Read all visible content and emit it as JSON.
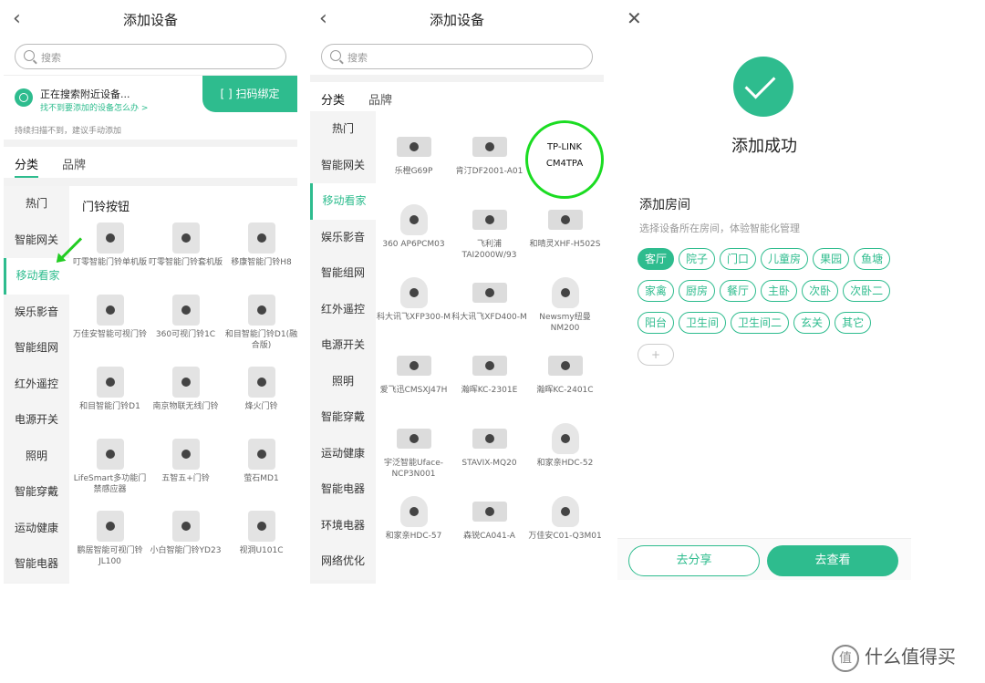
{
  "p1": {
    "title": "添加设备",
    "search_ph": "搜索",
    "scan1": "正在搜索附近设备...",
    "scan2": "找不到要添加的设备怎么办 >",
    "scan3": "持续扫描不到，建议手动添加",
    "scan_btn": "[ ] 扫码绑定",
    "tab1": "分类",
    "tab2": "品牌",
    "section": "门铃按钮",
    "side": [
      "热门",
      "智能网关",
      "移动看家",
      "娱乐影音",
      "智能组网",
      "红外遥控",
      "电源开关",
      "照明",
      "智能穿戴",
      "运动健康",
      "智能电器"
    ],
    "devices": [
      "叮零智能门铃单机版",
      "叮零智能门铃套机版",
      "移康智能门铃H8",
      "万佳安智能可视门铃",
      "360可视门铃1C",
      "和目智能门铃D1(融合版)",
      "和目智能门铃D1",
      "南京物联无线门铃",
      "烽火门铃",
      "LifeSmart多功能门禁感应器",
      "五智五+门铃",
      "萤石MD1",
      "鹏居智能可视门铃JL100",
      "小白智能门铃YD23",
      "视洞U101C"
    ]
  },
  "p2": {
    "title": "添加设备",
    "search_ph": "搜索",
    "tab1": "分类",
    "tab2": "品牌",
    "side": [
      "热门",
      "智能网关",
      "移动看家",
      "娱乐影音",
      "智能组网",
      "红外遥控",
      "电源开关",
      "照明",
      "智能穿戴",
      "运动健康",
      "智能电器",
      "环境电器",
      "网络优化"
    ],
    "devices": [
      "乐橙G69P",
      "肯汀DF2001-A01",
      "",
      "360 AP6PCM03",
      "飞利浦TAI2000W/93",
      "和晴灵XHF-H502S",
      "科大讯飞XFP300-M",
      "科大讯飞XFD400-M",
      "Newsmy纽曼NM200",
      "爱飞迅CMSXJ47H",
      "瀚晖KC-2301E",
      "瀚晖KC-2401C",
      "宇泛智能Uface-NCP3N001",
      "STAVIX-MQ20",
      "和家亲HDC-52",
      "和家亲HDC-57",
      "森锐CA041-A",
      "万佳安C01-Q3M01"
    ],
    "circle1": "TP-LINK",
    "circle2": "CM4TPA"
  },
  "p3": {
    "success": "添加成功",
    "room_title": "添加房间",
    "room_desc": "选择设备所在房间，体验智能化管理",
    "tags": [
      "客厅",
      "院子",
      "门口",
      "儿童房",
      "果园",
      "鱼塘",
      "家禽",
      "厨房",
      "餐厅",
      "主卧",
      "次卧",
      "次卧二",
      "阳台",
      "卫生间",
      "卫生间二",
      "玄关",
      "其它"
    ],
    "share": "去分享",
    "view": "去查看"
  },
  "watermark": "什么值得买",
  "watermark_logo": "值"
}
